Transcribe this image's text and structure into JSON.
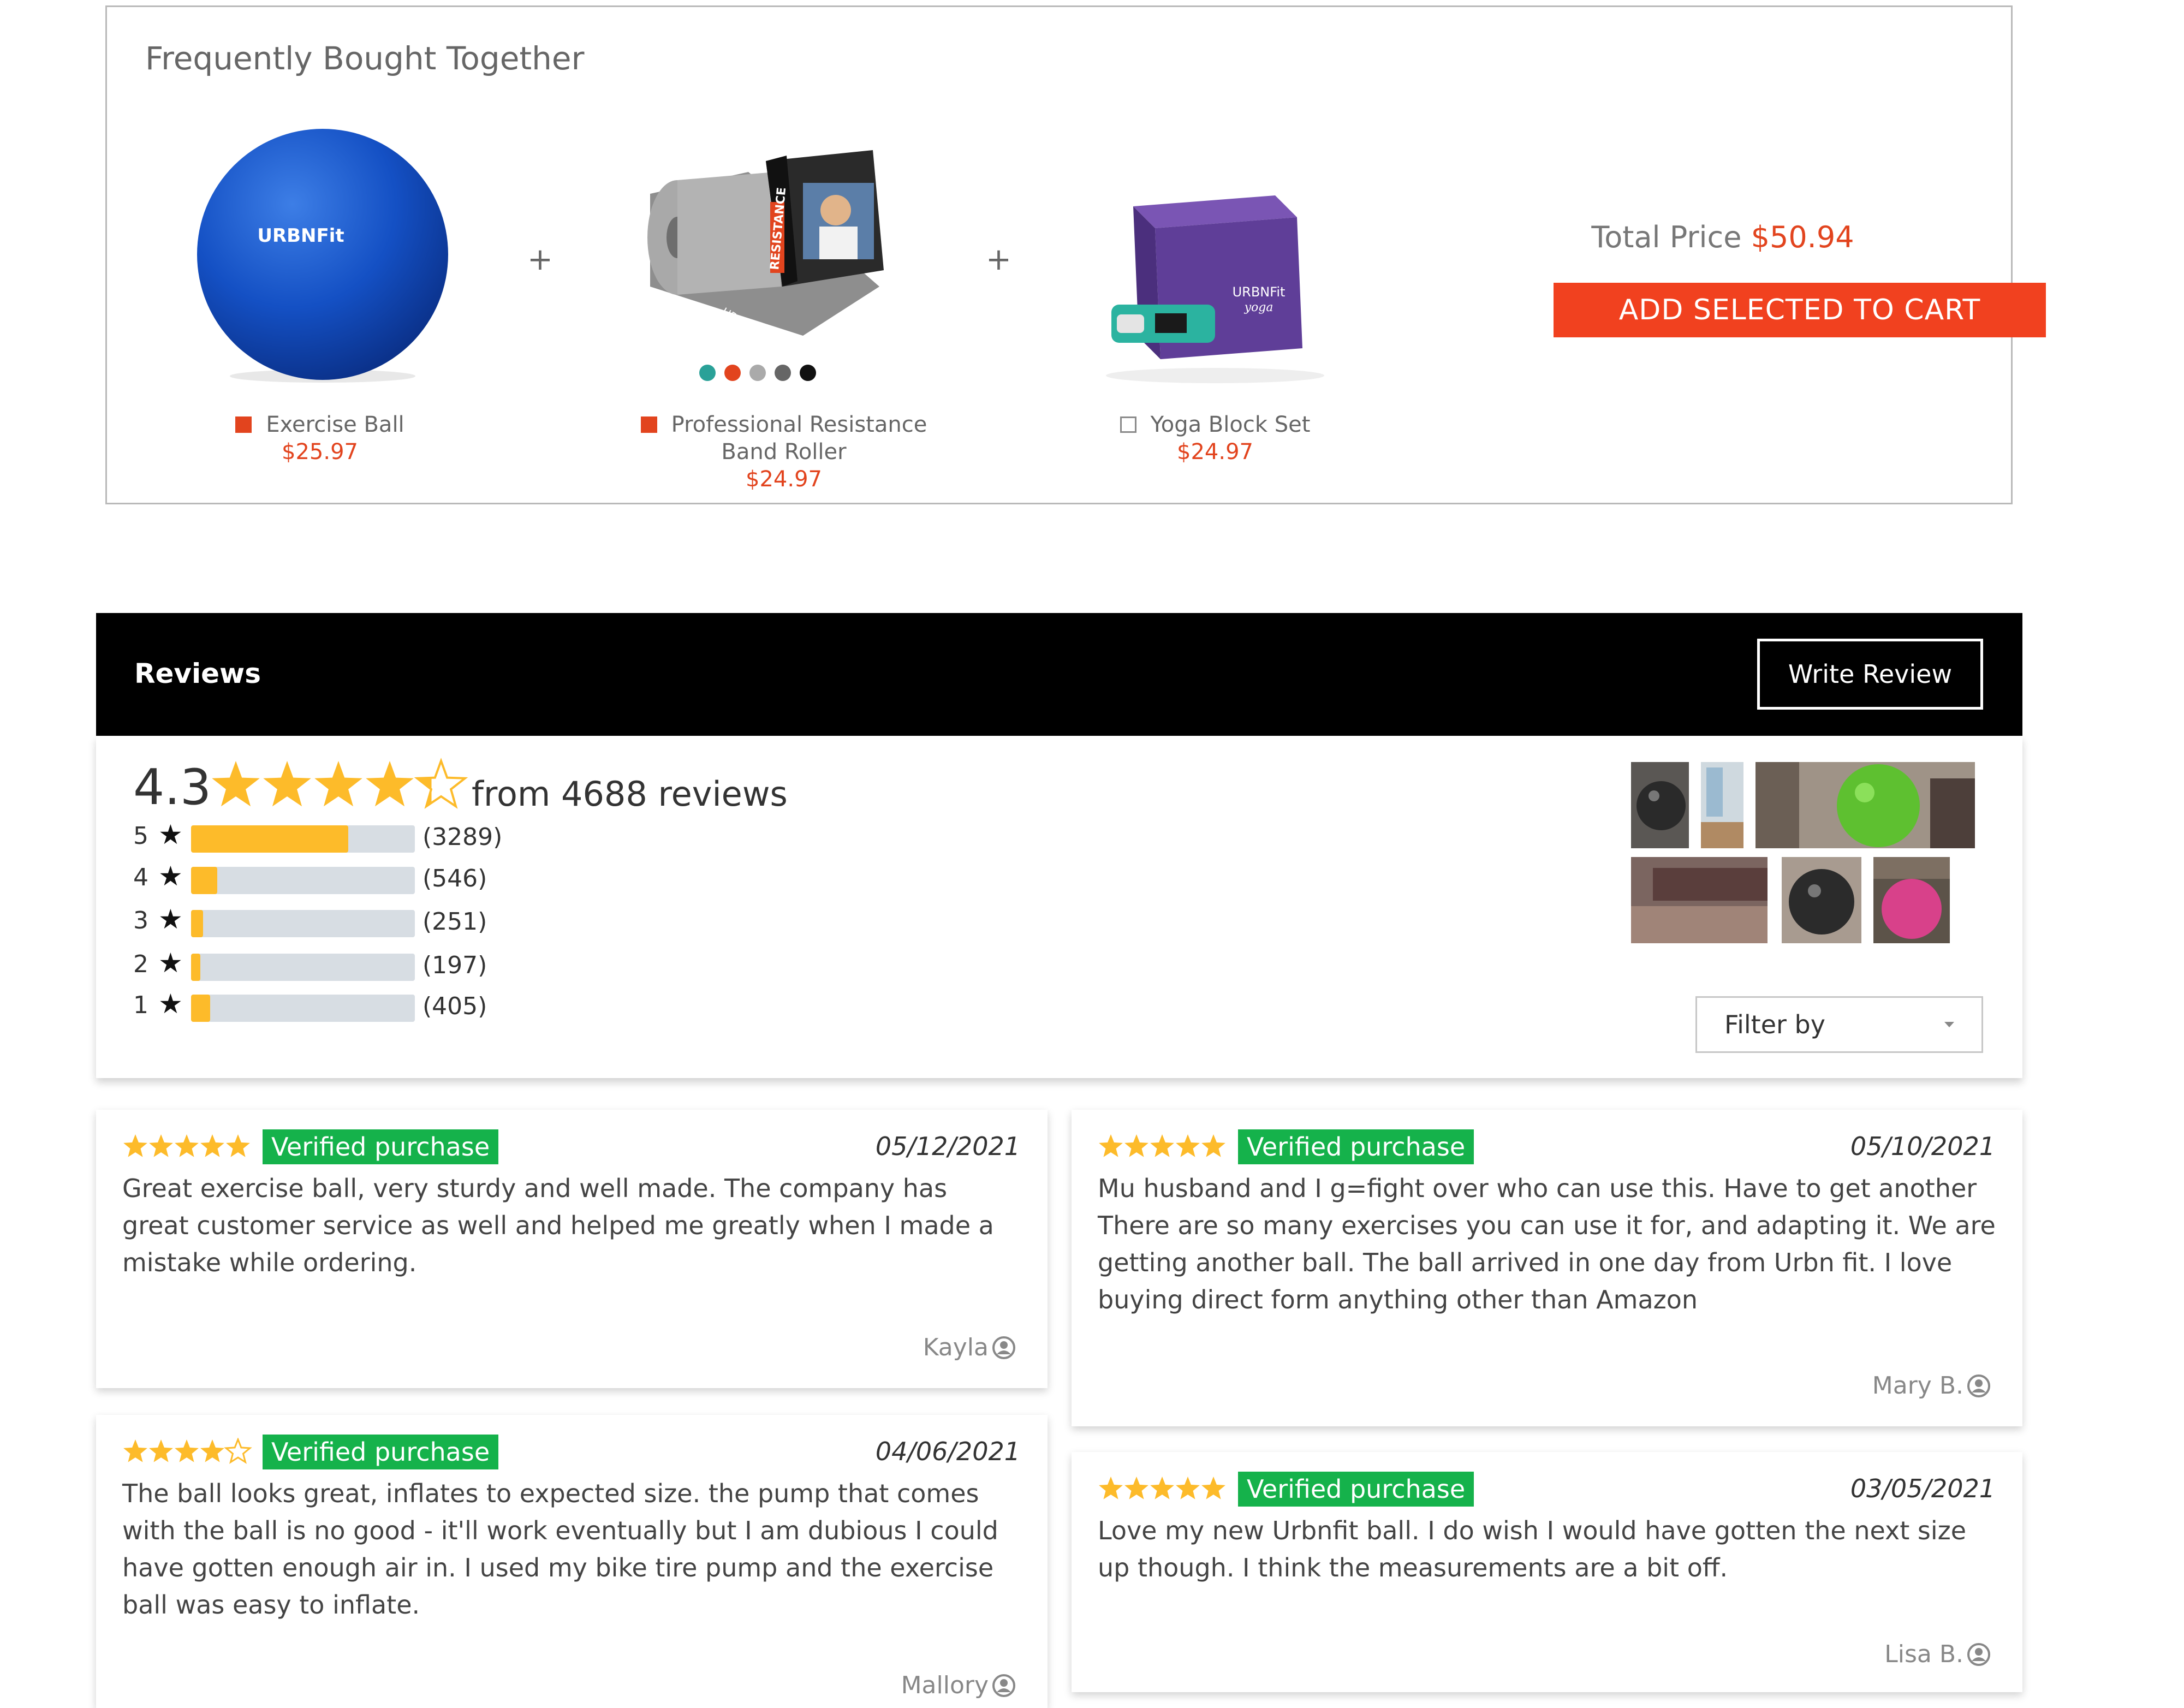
{
  "fbt": {
    "title": "Frequently Bought Together",
    "plus": "+",
    "products": [
      {
        "name": "Exercise Ball",
        "price": "$25.97",
        "selected": true,
        "icon": "exercise-ball-image"
      },
      {
        "name": "Professional Resistance Band Roller",
        "name_line1": "Professional Resistance",
        "name_line2": "Band Roller",
        "price": "$24.97",
        "selected": true,
        "icon": "resistance-band-image",
        "swatches": [
          "#2aa198",
          "#e2441e",
          "#aaaaaa",
          "#666666",
          "#111111"
        ]
      },
      {
        "name": "Yoga Block Set",
        "price": "$24.97",
        "selected": false,
        "icon": "yoga-block-image"
      }
    ],
    "total_label": "Total Price",
    "total_value": "$50.94",
    "add_button": "ADD SELECTED TO CART"
  },
  "reviews": {
    "title": "Reviews",
    "write_review": "Write Review",
    "average": "4.3",
    "average_rating": 4.3,
    "from_text": "from 4688 reviews",
    "histogram": [
      {
        "stars": "5",
        "count": "(3289)",
        "value": 3289
      },
      {
        "stars": "4",
        "count": "(546)",
        "value": 546
      },
      {
        "stars": "3",
        "count": "(251)",
        "value": 251
      },
      {
        "stars": "2",
        "count": "(197)",
        "value": 197
      },
      {
        "stars": "1",
        "count": "(405)",
        "value": 405
      }
    ],
    "filter_label": "Filter by",
    "items": [
      {
        "rating": 5,
        "badge": "Verified purchase",
        "date": "05/12/2021",
        "lines": [
          "Great exercise ball, very sturdy and well made. The company has",
          "great customer service as well and helped me greatly when I made a",
          "mistake while ordering."
        ],
        "author": "Kayla"
      },
      {
        "rating": 5,
        "badge": "Verified purchase",
        "date": "05/10/2021",
        "lines": [
          "Mu husband and I g=fight over who can use this. Have to get another",
          "There are so many exercises you can use it for, and adapting it. We are",
          "getting another ball. The ball arrived in one day from Urbn fit. I love",
          "buying direct form anything other than Amazon"
        ],
        "author": "Mary B."
      },
      {
        "rating": 4,
        "badge": "Verified purchase",
        "date": "04/06/2021",
        "lines": [
          "The ball looks great, inflates to expected size. the pump that comes",
          "with the ball is no good - it'll work eventually but I am dubious I could",
          "have gotten enough air in. I used my bike tire pump and the exercise",
          "ball was easy to inflate."
        ],
        "author": "Mallory"
      },
      {
        "rating": 5,
        "badge": "Verified purchase",
        "date": "03/05/2021",
        "lines": [
          "Love my new Urbnfit ball. I do wish I would have gotten the next size",
          "up though. I think the measurements are a bit off."
        ],
        "author": "Lisa B."
      }
    ]
  },
  "colors": {
    "accent": "#f1411f",
    "price": "#e2441e",
    "star": "#fdbb2a",
    "verified": "#15b24b"
  }
}
